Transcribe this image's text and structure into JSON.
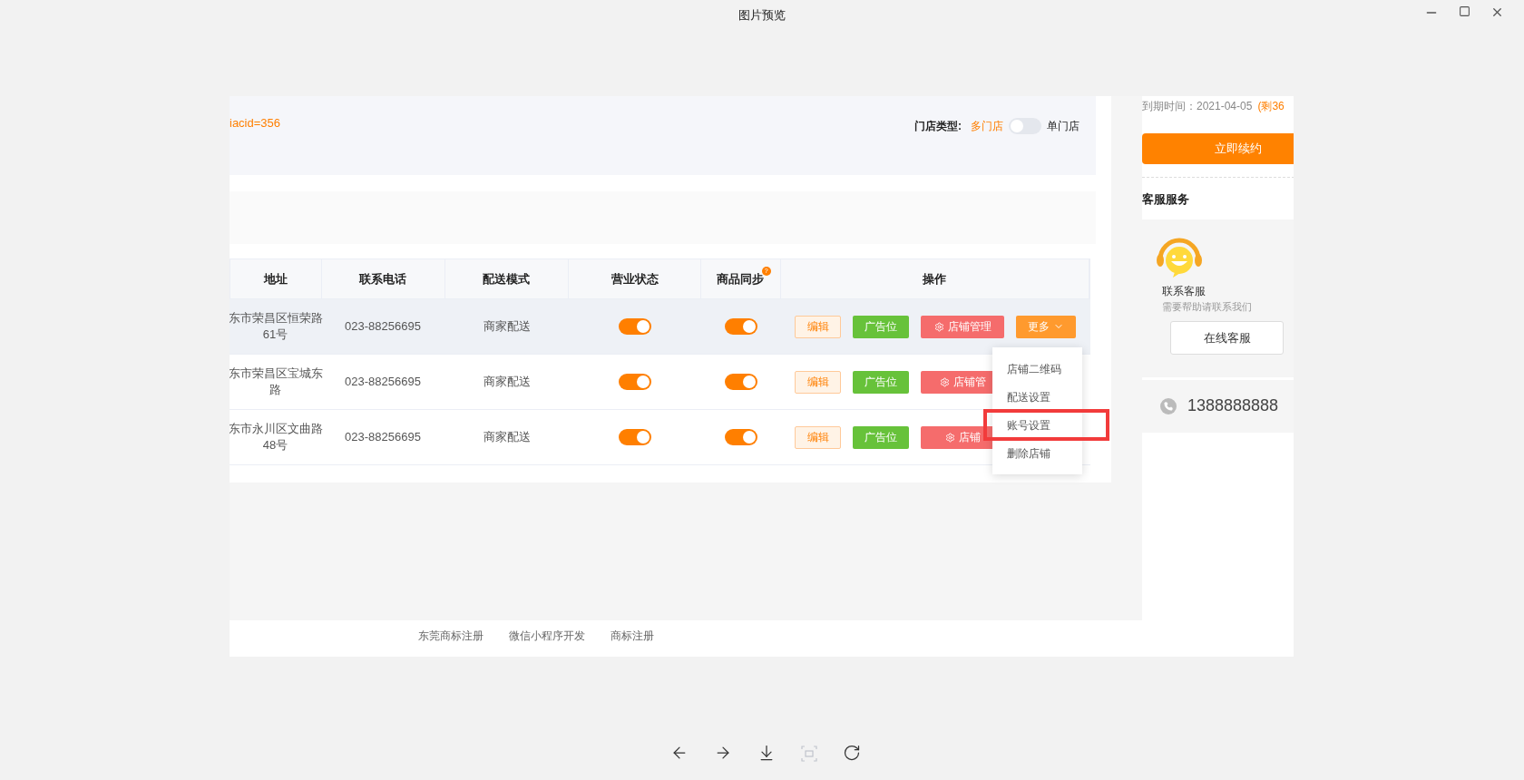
{
  "window": {
    "title": "图片预览"
  },
  "image": {
    "url_fragment": "iacid=356",
    "store_type": {
      "label": "门店类型:",
      "left": "多门店",
      "right": "单门店",
      "on": false
    },
    "table": {
      "columns": [
        {
          "label": "地址"
        },
        {
          "label": "联系电话"
        },
        {
          "label": "配送模式"
        },
        {
          "label": "营业状态"
        },
        {
          "label": "商品同步",
          "badge": "?"
        },
        {
          "label": "操作"
        }
      ],
      "rows": [
        {
          "address": "东市荣昌区恒荣路61号",
          "phone": "023-88256695",
          "delivery": "商家配送",
          "open": true,
          "sync": true,
          "selected": true,
          "edit": "编辑",
          "ad": "广告位",
          "manage": "店铺管理",
          "more": "更多"
        },
        {
          "address": "东市荣昌区宝城东路",
          "phone": "023-88256695",
          "delivery": "商家配送",
          "open": true,
          "sync": true,
          "selected": false,
          "edit": "编辑",
          "ad": "广告位",
          "manage": "店铺管"
        },
        {
          "address": "东市永川区文曲路48号",
          "phone": "023-88256695",
          "delivery": "商家配送",
          "open": true,
          "sync": true,
          "selected": false,
          "edit": "编辑",
          "ad": "广告位",
          "manage": "店铺"
        }
      ]
    },
    "more_menu": [
      {
        "label": "店铺二维码",
        "highlighted": false
      },
      {
        "label": "配送设置",
        "highlighted": false
      },
      {
        "label": "账号设置",
        "highlighted": true
      },
      {
        "label": "删除店铺",
        "highlighted": false
      }
    ],
    "sidebar": {
      "expiry": "到期时间：2021-04-05",
      "remaining": "(剩36",
      "renew": "立即续约",
      "service_title": "客服服务",
      "contact_title": "联系客服",
      "contact_hint": "需要帮助请联系我们",
      "online_button": "在线客服",
      "phone": "1388888888"
    },
    "footer_links": [
      "东莞商标注册",
      "微信小程序开发",
      "商标注册"
    ]
  },
  "toolbar": [
    {
      "kind": "prev",
      "disabled": false
    },
    {
      "kind": "next",
      "disabled": false
    },
    {
      "kind": "download",
      "disabled": false
    },
    {
      "kind": "fit",
      "disabled": true
    },
    {
      "kind": "rotate",
      "disabled": false
    }
  ]
}
